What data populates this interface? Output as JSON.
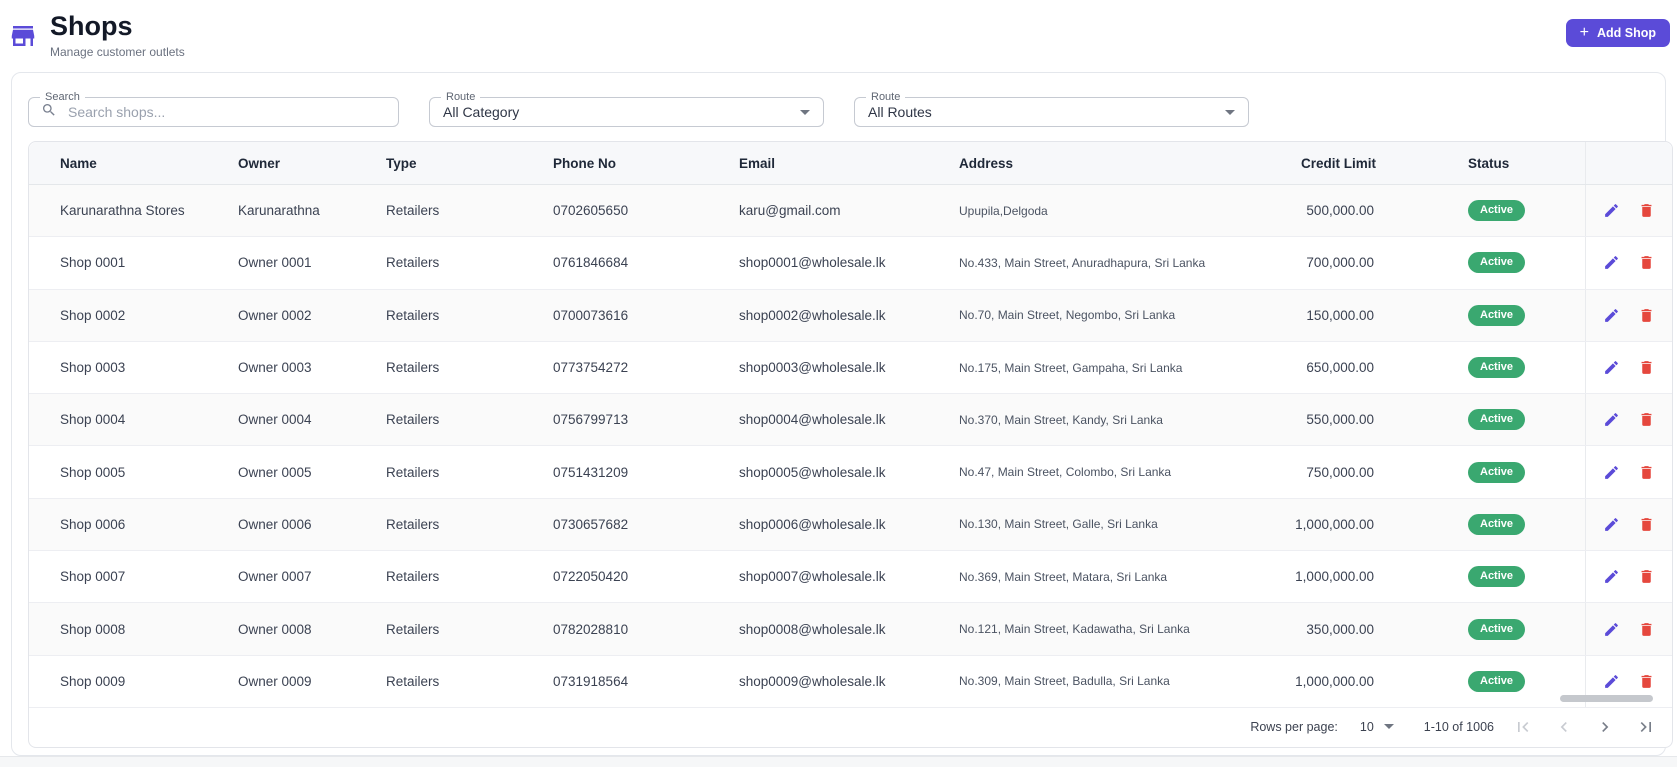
{
  "page": {
    "title": "Shops",
    "subtitle": "Manage customer outlets",
    "add_button_label": "Add Shop",
    "plus_icon": "+"
  },
  "filters": {
    "search_label": "Search",
    "search_placeholder": "Search shops...",
    "category_label": "Route",
    "category_value": "All Category",
    "route_label": "Route",
    "route_value": "All Routes"
  },
  "table": {
    "columns": [
      "Name",
      "Owner",
      "Type",
      "Phone No",
      "Email",
      "Address",
      "Credit Limit",
      "Status"
    ],
    "rows": [
      {
        "name": "Karunarathna Stores",
        "owner": "Karunarathna",
        "type": "Retailers",
        "phone": "0702605650",
        "email": "karu@gmail.com",
        "address": "Upupila,Delgoda",
        "credit": "500,000.00",
        "status": "Active"
      },
      {
        "name": "Shop 0001",
        "owner": "Owner 0001",
        "type": "Retailers",
        "phone": "0761846684",
        "email": "shop0001@wholesale.lk",
        "address": "No.433, Main Street, Anuradhapura, Sri Lanka",
        "credit": "700,000.00",
        "status": "Active"
      },
      {
        "name": "Shop 0002",
        "owner": "Owner 0002",
        "type": "Retailers",
        "phone": "0700073616",
        "email": "shop0002@wholesale.lk",
        "address": "No.70, Main Street, Negombo, Sri Lanka",
        "credit": "150,000.00",
        "status": "Active"
      },
      {
        "name": "Shop 0003",
        "owner": "Owner 0003",
        "type": "Retailers",
        "phone": "0773754272",
        "email": "shop0003@wholesale.lk",
        "address": "No.175, Main Street, Gampaha, Sri Lanka",
        "credit": "650,000.00",
        "status": "Active"
      },
      {
        "name": "Shop 0004",
        "owner": "Owner 0004",
        "type": "Retailers",
        "phone": "0756799713",
        "email": "shop0004@wholesale.lk",
        "address": "No.370, Main Street, Kandy, Sri Lanka",
        "credit": "550,000.00",
        "status": "Active"
      },
      {
        "name": "Shop 0005",
        "owner": "Owner 0005",
        "type": "Retailers",
        "phone": "0751431209",
        "email": "shop0005@wholesale.lk",
        "address": "No.47, Main Street, Colombo, Sri Lanka",
        "credit": "750,000.00",
        "status": "Active"
      },
      {
        "name": "Shop 0006",
        "owner": "Owner 0006",
        "type": "Retailers",
        "phone": "0730657682",
        "email": "shop0006@wholesale.lk",
        "address": "No.130, Main Street, Galle, Sri Lanka",
        "credit": "1,000,000.00",
        "status": "Active"
      },
      {
        "name": "Shop 0007",
        "owner": "Owner 0007",
        "type": "Retailers",
        "phone": "0722050420",
        "email": "shop0007@wholesale.lk",
        "address": "No.369, Main Street, Matara, Sri Lanka",
        "credit": "1,000,000.00",
        "status": "Active"
      },
      {
        "name": "Shop 0008",
        "owner": "Owner 0008",
        "type": "Retailers",
        "phone": "0782028810",
        "email": "shop0008@wholesale.lk",
        "address": "No.121, Main Street, Kadawatha, Sri Lanka",
        "credit": "350,000.00",
        "status": "Active"
      },
      {
        "name": "Shop 0009",
        "owner": "Owner 0009",
        "type": "Retailers",
        "phone": "0731918564",
        "email": "shop0009@wholesale.lk",
        "address": "No.309, Main Street, Badulla, Sri Lanka",
        "credit": "1,000,000.00",
        "status": "Active"
      }
    ]
  },
  "pagination": {
    "rows_per_page_label": "Rows per page:",
    "rows_per_page_value": "10",
    "range_text": "1-10 of 1006"
  },
  "colors": {
    "primary": "#5b4bd8",
    "success": "#3aa870",
    "danger": "#e5473d",
    "header_bg": "#f7f8fa"
  }
}
